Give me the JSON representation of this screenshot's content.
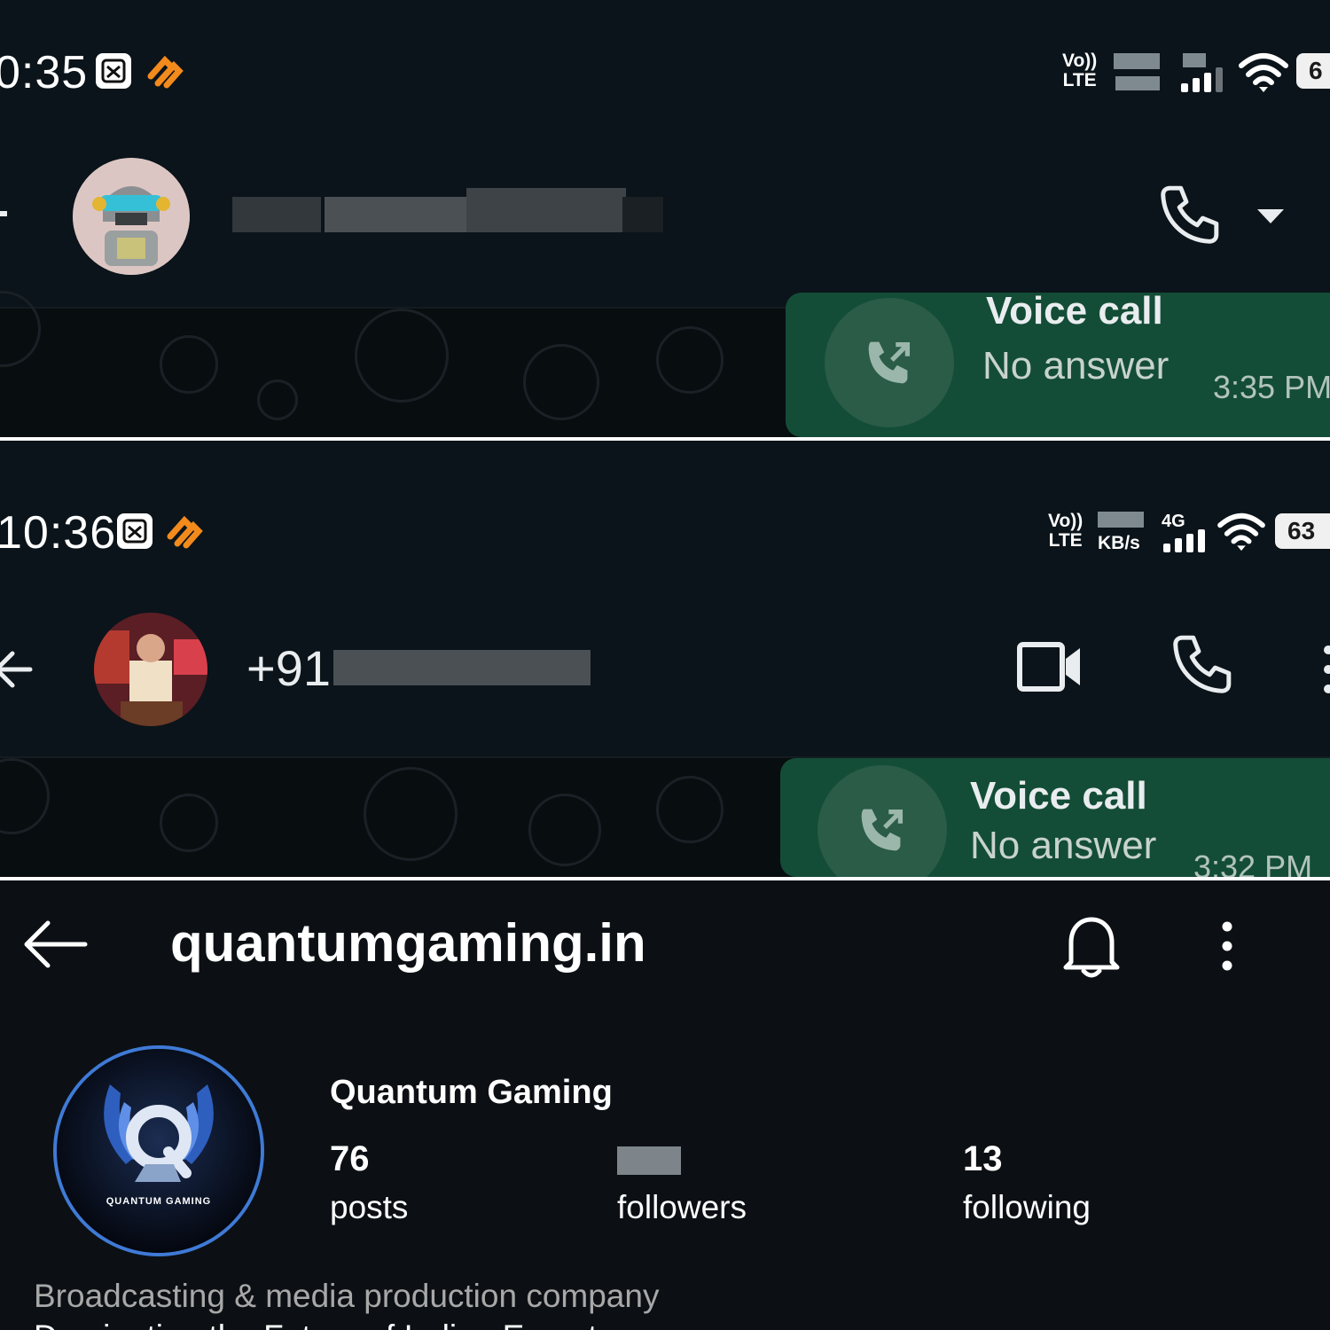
{
  "screens": [
    {
      "status": {
        "time": "0:35",
        "volte_top": "Vo))",
        "volte_bottom": "LTE",
        "battery": "6"
      },
      "header": {
        "contact_name": ""
      },
      "bubble": {
        "title": "Voice call",
        "subtitle": "No answer",
        "time": "3:35 PM"
      }
    },
    {
      "status": {
        "time": "10:36",
        "volte_top": "Vo))",
        "volte_bottom": "LTE",
        "speed_unit": "KB/s",
        "network": "4G",
        "battery": "63"
      },
      "header": {
        "contact_name": "+91"
      },
      "bubble": {
        "title": "Voice call",
        "subtitle": "No answer",
        "time": "3:32 PM"
      }
    }
  ],
  "profile": {
    "username": "quantumgaming.in",
    "display_name": "Quantum Gaming",
    "logo_text": "QUANTUM GAMING",
    "stats": [
      {
        "value": "76",
        "label": "posts"
      },
      {
        "value": "",
        "label": "followers"
      },
      {
        "value": "13",
        "label": "following"
      }
    ],
    "category": "Broadcasting & media production company",
    "bio_partial": "Dominating the Future of Indian Esports"
  },
  "icons": {
    "back": "arrow-left-icon",
    "call": "phone-icon",
    "video": "video-camera-icon",
    "dropdown": "caret-down-icon",
    "menu": "kebab-menu-icon",
    "bell": "bell-icon",
    "missed_call": "phone-outgoing-icon"
  },
  "colors": {
    "bubble": "#144d37",
    "background": "#0b141a"
  }
}
